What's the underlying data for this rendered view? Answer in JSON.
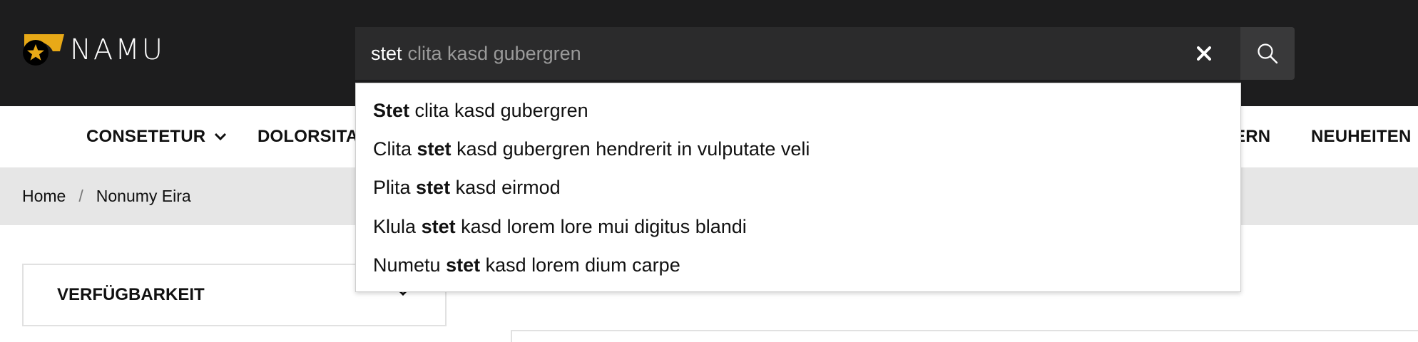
{
  "brand": {
    "name": "NAMU",
    "accent": "#e8a917"
  },
  "search": {
    "typed": "stet",
    "completion": "clita kasd gubergren",
    "clear_icon": "close-icon",
    "submit_icon": "search-icon"
  },
  "nav": {
    "items": [
      {
        "label": "CONSETETUR",
        "has_dropdown": true
      },
      {
        "label": "DOLORSITAM",
        "has_dropdown": false
      },
      {
        "label": "ERN",
        "has_dropdown": false
      },
      {
        "label": "NEUHEITEN",
        "has_dropdown": false
      }
    ]
  },
  "breadcrumb": {
    "home": "Home",
    "separator": "/",
    "current": "Nonumy Eira"
  },
  "filters": {
    "availability_label": "VERFÜGBARKEIT"
  },
  "suggestions": [
    {
      "before": "",
      "match": "Stet",
      "after": "clita kasd gubergren"
    },
    {
      "before": "Clita",
      "match": "stet",
      "after": "kasd gubergren hendrerit in vulputate veli"
    },
    {
      "before": "Plita",
      "match": "stet",
      "after": "kasd eirmod"
    },
    {
      "before": "Klula",
      "match": "stet",
      "after": "kasd lorem lore mui digitus blandi"
    },
    {
      "before": "Numetu",
      "match": "stet",
      "after": "kasd lorem dium carpe"
    }
  ]
}
